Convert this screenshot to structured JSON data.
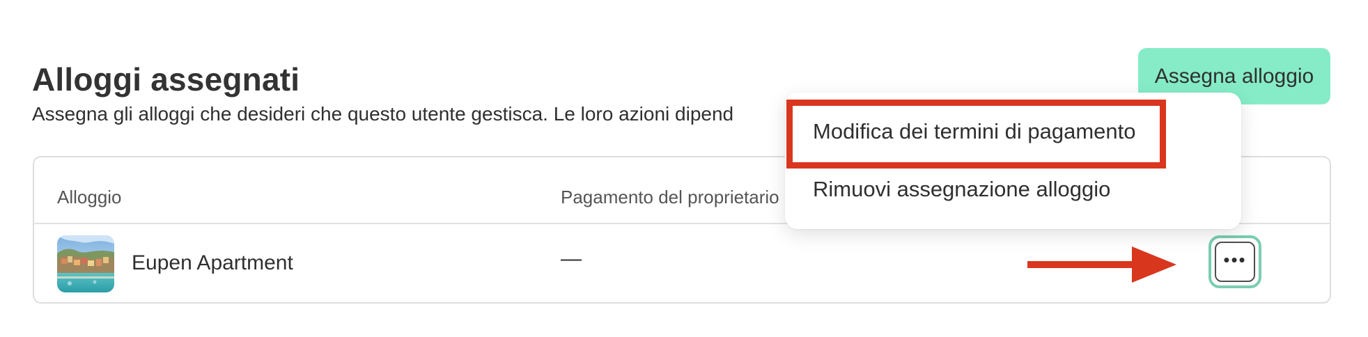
{
  "header": {
    "title": "Alloggi assegnati",
    "description": "Assegna gli alloggi che desideri che questo utente gestisca. Le loro azioni dipend",
    "assign_button": "Assegna alloggio"
  },
  "table": {
    "columns": [
      "Alloggio",
      "Pagamento del proprietario"
    ],
    "rows": [
      {
        "name": "Eupen Apartment",
        "payment": "—"
      }
    ]
  },
  "menu": {
    "items": [
      "Modifica dei termini di pagamento",
      "Rimuovi assegnazione alloggio"
    ]
  },
  "colors": {
    "accent": "#86ecc8",
    "highlight": "#d9361e",
    "focus": "#79cdb3"
  },
  "icons": {
    "row_actions": "more-horizontal-icon",
    "annotation_arrow": "arrow-right-icon"
  }
}
